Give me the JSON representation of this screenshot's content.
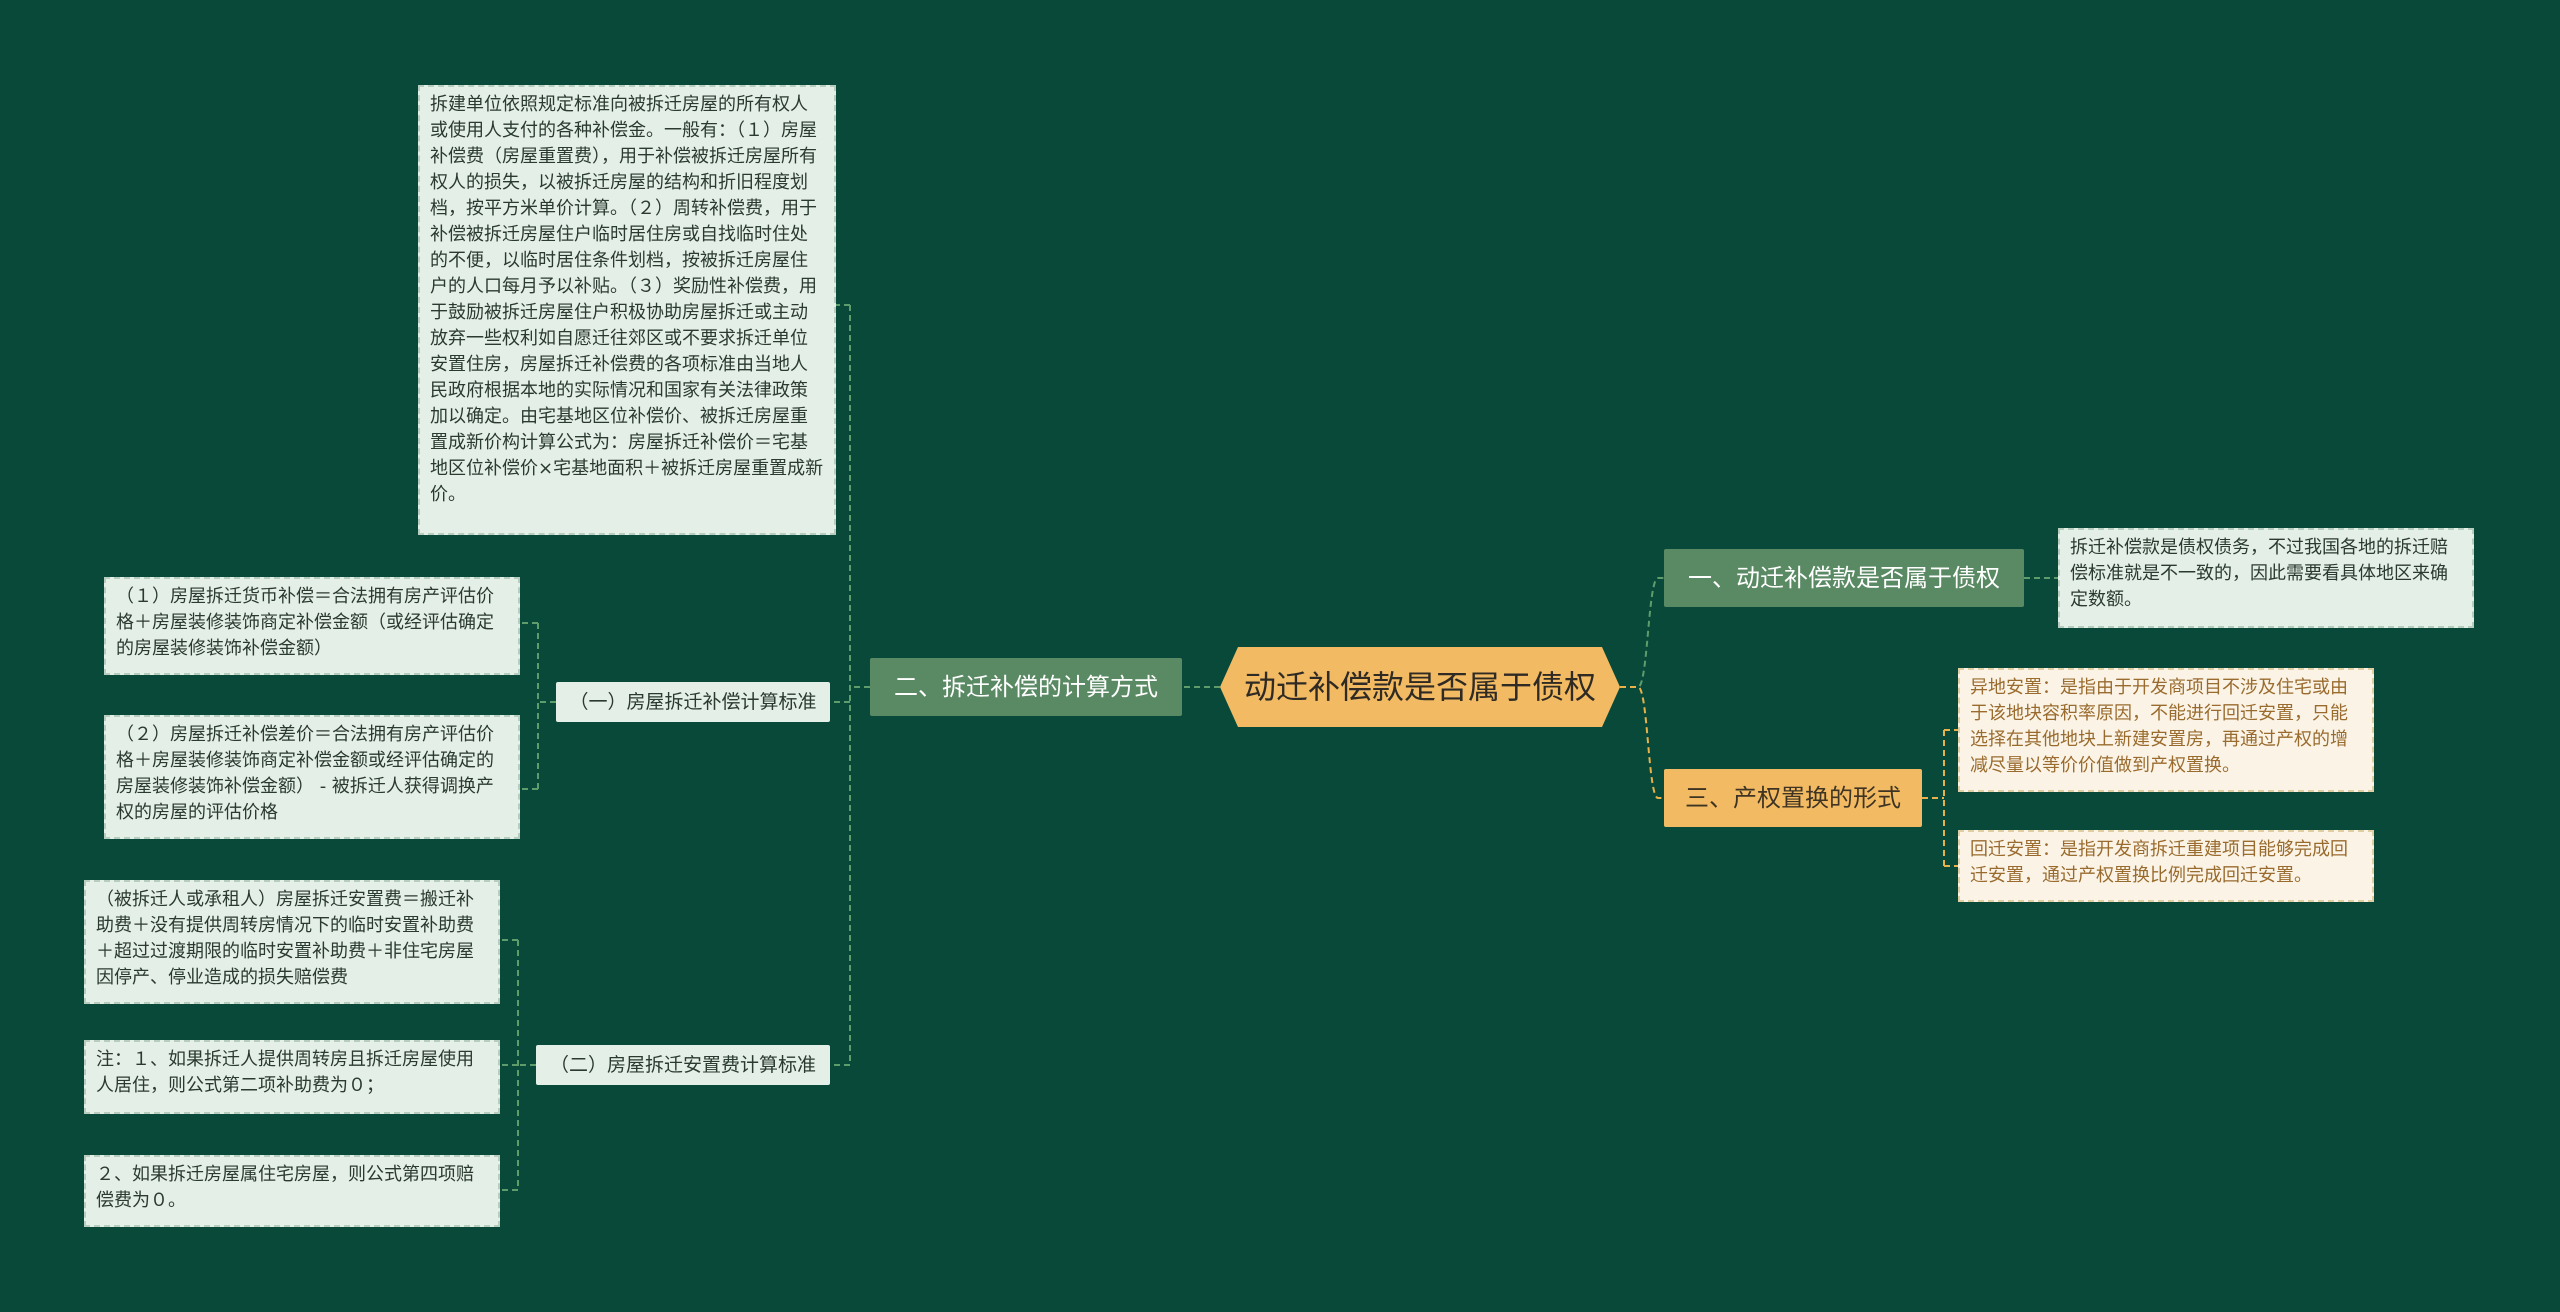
{
  "root": {
    "label": "动迁补偿款是否属于债权"
  },
  "branches": {
    "b1": {
      "label": "一、动迁补偿款是否属于债权"
    },
    "b2": {
      "label": "二、拆迁补偿的计算方式"
    },
    "b3": {
      "label": "三、产权置换的形式"
    }
  },
  "subs": {
    "s1": {
      "label": "（一）房屋拆迁补偿计算标准"
    },
    "s2": {
      "label": "（二）房屋拆迁安置费计算标准"
    }
  },
  "leaves": {
    "top": "拆建单位依照规定标准向被拆迁房屋的所有权人或使用人支付的各种补偿金。一般有：（１）房屋补偿费（房屋重置费），用于补偿被拆迁房屋所有权人的损失，以被拆迁房屋的结构和折旧程度划档，按平方米单价计算。（２）周转补偿费，用于补偿被拆迁房屋住户临时居住房或自找临时住处的不便，以临时居住条件划档，按被拆迁房屋住户的人口每月予以补贴。（３）奖励性补偿费，用于鼓励被拆迁房屋住户积极协助房屋拆迁或主动放弃一些权利如自愿迁往郊区或不要求拆迁单位安置住房，房屋拆迁补偿费的各项标准由当地人民政府根据本地的实际情况和国家有关法律政策加以确定。由宅基地区位补偿价、被拆迁房屋重置成新价构计算公式为：房屋拆迁补偿价＝宅基地区位补偿价×宅基地面积＋被拆迁房屋重置成新价。",
    "s1a": "（１）房屋拆迁货币补偿＝合法拥有房产评估价格＋房屋装修装饰商定补偿金额（或经评估确定的房屋装修装饰补偿金额）",
    "s1b": "（２）房屋拆迁补偿差价＝合法拥有房产评估价格＋房屋装修装饰商定补偿金额或经评估确定的房屋装修装饰补偿金额） - 被拆迁人获得调换产权的房屋的评估价格",
    "s2a": "（被拆迁人或承租人）房屋拆迁安置费＝搬迁补助费＋没有提供周转房情况下的临时安置补助费＋超过过渡期限的临时安置补助费＋非住宅房屋因停产、停业造成的损失赔偿费",
    "s2b": "注：１、如果拆迁人提供周转房且拆迁房屋使用人居住，则公式第二项补助费为０；",
    "s2c": "２、如果拆迁房屋属住宅房屋，则公式第四项赔偿费为０。",
    "b1a": "拆迁补偿款是债权债务，不过我国各地的拆迁赔偿标准就是不一致的，因此需要看具体地区来确定数额。",
    "b3a": "异地安置：是指由于开发商项目不涉及住宅或由于该地块容积率原因，不能进行回迁安置，只能选择在其他地块上新建安置房，再通过产权的增减尽量以等价价值做到产权置换。",
    "b3b": "回迁安置：是指开发商拆迁重建项目能够完成回迁安置，通过产权置换比例完成回迁安置。"
  },
  "colors": {
    "background": "#08493a",
    "green_branch": "#5a8a63",
    "orange": "#f2bb63",
    "link_green": "#5e9d6b",
    "link_orange": "#e8b14a"
  }
}
